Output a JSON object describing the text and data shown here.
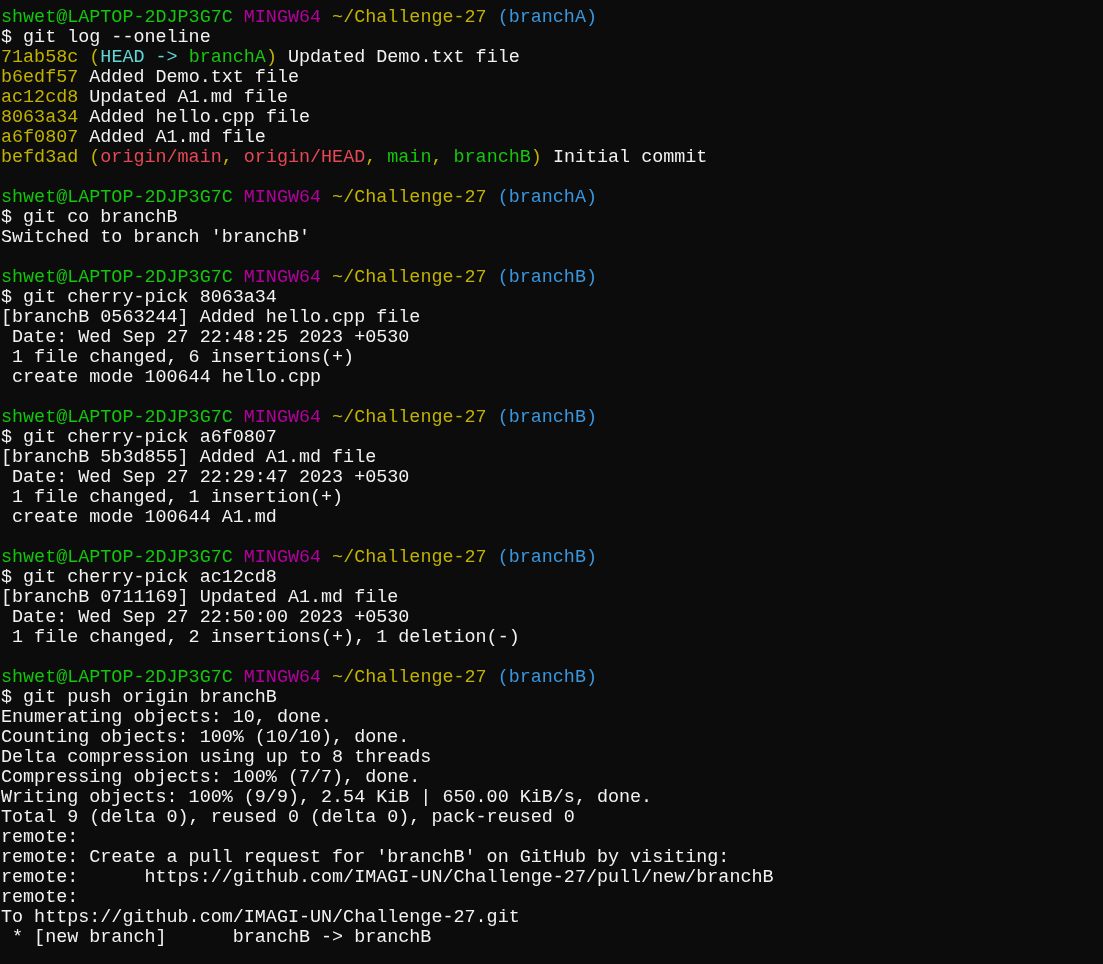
{
  "terminal": {
    "lines": [
      {
        "kind": "prompt",
        "segments": [
          {
            "text": "shwet@LAPTOP-2DJP3G7C ",
            "color": "#13c60c"
          },
          {
            "text": "MINGW64 ",
            "color": "#b4009e"
          },
          {
            "text": "~/Challenge-27 ",
            "color": "#c1b200"
          },
          {
            "text": "(branchA)",
            "color": "#3a96dd"
          }
        ]
      },
      {
        "kind": "text",
        "segments": [
          {
            "text": "$ git log --oneline",
            "color": "#f2f2f2"
          }
        ]
      },
      {
        "kind": "text",
        "segments": [
          {
            "text": "71ab58c ",
            "color": "#c1b200"
          },
          {
            "text": "(",
            "color": "#c1b200"
          },
          {
            "text": "HEAD -> ",
            "color": "#61d6d6"
          },
          {
            "text": "branchA",
            "color": "#16c60c"
          },
          {
            "text": ")",
            "color": "#c1b200"
          },
          {
            "text": " Updated Demo.txt file",
            "color": "#f2f2f2"
          }
        ]
      },
      {
        "kind": "text",
        "segments": [
          {
            "text": "b6edf57",
            "color": "#c1b200"
          },
          {
            "text": " Added Demo.txt file",
            "color": "#f2f2f2"
          }
        ]
      },
      {
        "kind": "text",
        "segments": [
          {
            "text": "ac12cd8",
            "color": "#c1b200"
          },
          {
            "text": " Updated A1.md file",
            "color": "#f2f2f2"
          }
        ]
      },
      {
        "kind": "text",
        "segments": [
          {
            "text": "8063a34",
            "color": "#c1b200"
          },
          {
            "text": " Added hello.cpp file",
            "color": "#f2f2f2"
          }
        ]
      },
      {
        "kind": "text",
        "segments": [
          {
            "text": "a6f0807",
            "color": "#c1b200"
          },
          {
            "text": " Added A1.md file",
            "color": "#f2f2f2"
          }
        ]
      },
      {
        "kind": "text",
        "segments": [
          {
            "text": "befd3ad (",
            "color": "#c1b200"
          },
          {
            "text": "origin/main",
            "color": "#e74856"
          },
          {
            "text": ", ",
            "color": "#c1b200"
          },
          {
            "text": "origin/HEAD",
            "color": "#e74856"
          },
          {
            "text": ", ",
            "color": "#c1b200"
          },
          {
            "text": "main",
            "color": "#16c60c"
          },
          {
            "text": ", ",
            "color": "#c1b200"
          },
          {
            "text": "branchB",
            "color": "#16c60c"
          },
          {
            "text": ")",
            "color": "#c1b200"
          },
          {
            "text": " Initial commit",
            "color": "#f2f2f2"
          }
        ]
      },
      {
        "kind": "blank"
      },
      {
        "kind": "prompt",
        "segments": [
          {
            "text": "shwet@LAPTOP-2DJP3G7C ",
            "color": "#13c60c"
          },
          {
            "text": "MINGW64 ",
            "color": "#b4009e"
          },
          {
            "text": "~/Challenge-27 ",
            "color": "#c1b200"
          },
          {
            "text": "(branchA)",
            "color": "#3a96dd"
          }
        ]
      },
      {
        "kind": "text",
        "segments": [
          {
            "text": "$ git co branchB",
            "color": "#f2f2f2"
          }
        ]
      },
      {
        "kind": "text",
        "segments": [
          {
            "text": "Switched to branch 'branchB'",
            "color": "#f2f2f2"
          }
        ]
      },
      {
        "kind": "blank"
      },
      {
        "kind": "prompt",
        "segments": [
          {
            "text": "shwet@LAPTOP-2DJP3G7C ",
            "color": "#13c60c"
          },
          {
            "text": "MINGW64 ",
            "color": "#b4009e"
          },
          {
            "text": "~/Challenge-27 ",
            "color": "#c1b200"
          },
          {
            "text": "(branchB)",
            "color": "#3a96dd"
          }
        ]
      },
      {
        "kind": "text",
        "segments": [
          {
            "text": "$ git cherry-pick 8063a34",
            "color": "#f2f2f2"
          }
        ]
      },
      {
        "kind": "text",
        "segments": [
          {
            "text": "[branchB 0563244] Added hello.cpp file",
            "color": "#f2f2f2"
          }
        ]
      },
      {
        "kind": "text",
        "segments": [
          {
            "text": " Date: Wed Sep 27 22:48:25 2023 +0530",
            "color": "#f2f2f2"
          }
        ]
      },
      {
        "kind": "text",
        "segments": [
          {
            "text": " 1 file changed, 6 insertions(+)",
            "color": "#f2f2f2"
          }
        ]
      },
      {
        "kind": "text",
        "segments": [
          {
            "text": " create mode 100644 hello.cpp",
            "color": "#f2f2f2"
          }
        ]
      },
      {
        "kind": "blank"
      },
      {
        "kind": "prompt",
        "segments": [
          {
            "text": "shwet@LAPTOP-2DJP3G7C ",
            "color": "#13c60c"
          },
          {
            "text": "MINGW64 ",
            "color": "#b4009e"
          },
          {
            "text": "~/Challenge-27 ",
            "color": "#c1b200"
          },
          {
            "text": "(branchB)",
            "color": "#3a96dd"
          }
        ]
      },
      {
        "kind": "text",
        "segments": [
          {
            "text": "$ git cherry-pick a6f0807",
            "color": "#f2f2f2"
          }
        ]
      },
      {
        "kind": "text",
        "segments": [
          {
            "text": "[branchB 5b3d855] Added A1.md file",
            "color": "#f2f2f2"
          }
        ]
      },
      {
        "kind": "text",
        "segments": [
          {
            "text": " Date: Wed Sep 27 22:29:47 2023 +0530",
            "color": "#f2f2f2"
          }
        ]
      },
      {
        "kind": "text",
        "segments": [
          {
            "text": " 1 file changed, 1 insertion(+)",
            "color": "#f2f2f2"
          }
        ]
      },
      {
        "kind": "text",
        "segments": [
          {
            "text": " create mode 100644 A1.md",
            "color": "#f2f2f2"
          }
        ]
      },
      {
        "kind": "blank"
      },
      {
        "kind": "prompt",
        "segments": [
          {
            "text": "shwet@LAPTOP-2DJP3G7C ",
            "color": "#13c60c"
          },
          {
            "text": "MINGW64 ",
            "color": "#b4009e"
          },
          {
            "text": "~/Challenge-27 ",
            "color": "#c1b200"
          },
          {
            "text": "(branchB)",
            "color": "#3a96dd"
          }
        ]
      },
      {
        "kind": "text",
        "segments": [
          {
            "text": "$ git cherry-pick ac12cd8",
            "color": "#f2f2f2"
          }
        ]
      },
      {
        "kind": "text",
        "segments": [
          {
            "text": "[branchB 0711169] Updated A1.md file",
            "color": "#f2f2f2"
          }
        ]
      },
      {
        "kind": "text",
        "segments": [
          {
            "text": " Date: Wed Sep 27 22:50:00 2023 +0530",
            "color": "#f2f2f2"
          }
        ]
      },
      {
        "kind": "text",
        "segments": [
          {
            "text": " 1 file changed, 2 insertions(+), 1 deletion(-)",
            "color": "#f2f2f2"
          }
        ]
      },
      {
        "kind": "blank"
      },
      {
        "kind": "prompt",
        "segments": [
          {
            "text": "shwet@LAPTOP-2DJP3G7C ",
            "color": "#13c60c"
          },
          {
            "text": "MINGW64 ",
            "color": "#b4009e"
          },
          {
            "text": "~/Challenge-27 ",
            "color": "#c1b200"
          },
          {
            "text": "(branchB)",
            "color": "#3a96dd"
          }
        ]
      },
      {
        "kind": "text",
        "segments": [
          {
            "text": "$ git push origin branchB",
            "color": "#f2f2f2"
          }
        ]
      },
      {
        "kind": "text",
        "segments": [
          {
            "text": "Enumerating objects: 10, done.",
            "color": "#f2f2f2"
          }
        ]
      },
      {
        "kind": "text",
        "segments": [
          {
            "text": "Counting objects: 100% (10/10), done.",
            "color": "#f2f2f2"
          }
        ]
      },
      {
        "kind": "text",
        "segments": [
          {
            "text": "Delta compression using up to 8 threads",
            "color": "#f2f2f2"
          }
        ]
      },
      {
        "kind": "text",
        "segments": [
          {
            "text": "Compressing objects: 100% (7/7), done.",
            "color": "#f2f2f2"
          }
        ]
      },
      {
        "kind": "text",
        "segments": [
          {
            "text": "Writing objects: 100% (9/9), 2.54 KiB | 650.00 KiB/s, done.",
            "color": "#f2f2f2"
          }
        ]
      },
      {
        "kind": "text",
        "segments": [
          {
            "text": "Total 9 (delta 0), reused 0 (delta 0), pack-reused 0",
            "color": "#f2f2f2"
          }
        ]
      },
      {
        "kind": "text",
        "segments": [
          {
            "text": "remote:",
            "color": "#f2f2f2"
          }
        ]
      },
      {
        "kind": "text",
        "segments": [
          {
            "text": "remote: Create a pull request for 'branchB' on GitHub by visiting:",
            "color": "#f2f2f2"
          }
        ]
      },
      {
        "kind": "text",
        "segments": [
          {
            "text": "remote:      https://github.com/IMAGI-UN/Challenge-27/pull/new/branchB",
            "color": "#f2f2f2"
          }
        ]
      },
      {
        "kind": "text",
        "segments": [
          {
            "text": "remote:",
            "color": "#f2f2f2"
          }
        ]
      },
      {
        "kind": "text",
        "segments": [
          {
            "text": "To https://github.com/IMAGI-UN/Challenge-27.git",
            "color": "#f2f2f2"
          }
        ]
      },
      {
        "kind": "text",
        "segments": [
          {
            "text": " * [new branch]      branchB -> branchB",
            "color": "#f2f2f2"
          }
        ]
      }
    ]
  }
}
